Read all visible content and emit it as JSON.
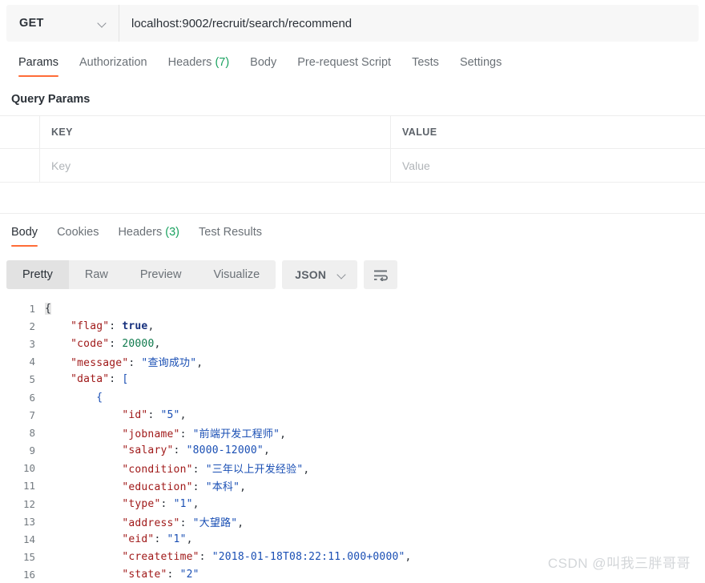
{
  "request_bar": {
    "method": "GET",
    "method_caret_icon": "chevron-down-icon",
    "url": "localhost:9002/recruit/search/recommend"
  },
  "request_tabs": [
    {
      "label": "Params",
      "active": true,
      "count": ""
    },
    {
      "label": "Authorization",
      "active": false,
      "count": ""
    },
    {
      "label": "Headers",
      "active": false,
      "count": "(7)"
    },
    {
      "label": "Body",
      "active": false,
      "count": ""
    },
    {
      "label": "Pre-request Script",
      "active": false,
      "count": ""
    },
    {
      "label": "Tests",
      "active": false,
      "count": ""
    },
    {
      "label": "Settings",
      "active": false,
      "count": ""
    }
  ],
  "query_params": {
    "section_title": "Query Params",
    "columns": [
      "KEY",
      "VALUE"
    ],
    "empty_row": {
      "key_placeholder": "Key",
      "value_placeholder": "Value"
    }
  },
  "response_tabs": [
    {
      "label": "Body",
      "active": true,
      "count": ""
    },
    {
      "label": "Cookies",
      "active": false,
      "count": ""
    },
    {
      "label": "Headers",
      "active": false,
      "count": "(3)"
    },
    {
      "label": "Test Results",
      "active": false,
      "count": ""
    }
  ],
  "view_toolbar": {
    "modes": [
      {
        "label": "Pretty",
        "active": true
      },
      {
        "label": "Raw",
        "active": false
      },
      {
        "label": "Preview",
        "active": false
      },
      {
        "label": "Visualize",
        "active": false
      }
    ],
    "format": "JSON",
    "format_caret_icon": "chevron-down-icon",
    "wrap_icon": "wrap-text-icon"
  },
  "response_body": {
    "language": "json",
    "lines": [
      {
        "num": "1",
        "indent": 0,
        "tokens": [
          {
            "t": "{",
            "c": "p brace-hl"
          }
        ]
      },
      {
        "num": "2",
        "indent": 1,
        "tokens": [
          {
            "t": "\"flag\"",
            "c": "k"
          },
          {
            "t": ": ",
            "c": "p"
          },
          {
            "t": "true",
            "c": "b"
          },
          {
            "t": ",",
            "c": "p"
          }
        ]
      },
      {
        "num": "3",
        "indent": 1,
        "tokens": [
          {
            "t": "\"code\"",
            "c": "k"
          },
          {
            "t": ": ",
            "c": "p"
          },
          {
            "t": "20000",
            "c": "n"
          },
          {
            "t": ",",
            "c": "p"
          }
        ]
      },
      {
        "num": "4",
        "indent": 1,
        "tokens": [
          {
            "t": "\"message\"",
            "c": "k"
          },
          {
            "t": ": ",
            "c": "p"
          },
          {
            "t": "\"查询成功\"",
            "c": "s"
          },
          {
            "t": ",",
            "c": "p"
          }
        ]
      },
      {
        "num": "5",
        "indent": 1,
        "tokens": [
          {
            "t": "\"data\"",
            "c": "k"
          },
          {
            "t": ": ",
            "c": "p"
          },
          {
            "t": "[",
            "c": "s"
          }
        ]
      },
      {
        "num": "6",
        "indent": 2,
        "tokens": [
          {
            "t": "{",
            "c": "s"
          }
        ]
      },
      {
        "num": "7",
        "indent": 3,
        "tokens": [
          {
            "t": "\"id\"",
            "c": "k"
          },
          {
            "t": ": ",
            "c": "p"
          },
          {
            "t": "\"5\"",
            "c": "s"
          },
          {
            "t": ",",
            "c": "p"
          }
        ]
      },
      {
        "num": "8",
        "indent": 3,
        "tokens": [
          {
            "t": "\"jobname\"",
            "c": "k"
          },
          {
            "t": ": ",
            "c": "p"
          },
          {
            "t": "\"前端开发工程师\"",
            "c": "s"
          },
          {
            "t": ",",
            "c": "p"
          }
        ]
      },
      {
        "num": "9",
        "indent": 3,
        "tokens": [
          {
            "t": "\"salary\"",
            "c": "k"
          },
          {
            "t": ": ",
            "c": "p"
          },
          {
            "t": "\"8000-12000\"",
            "c": "s"
          },
          {
            "t": ",",
            "c": "p"
          }
        ]
      },
      {
        "num": "10",
        "indent": 3,
        "tokens": [
          {
            "t": "\"condition\"",
            "c": "k"
          },
          {
            "t": ": ",
            "c": "p"
          },
          {
            "t": "\"三年以上开发经验\"",
            "c": "s"
          },
          {
            "t": ",",
            "c": "p"
          }
        ]
      },
      {
        "num": "11",
        "indent": 3,
        "tokens": [
          {
            "t": "\"education\"",
            "c": "k"
          },
          {
            "t": ": ",
            "c": "p"
          },
          {
            "t": "\"本科\"",
            "c": "s"
          },
          {
            "t": ",",
            "c": "p"
          }
        ]
      },
      {
        "num": "12",
        "indent": 3,
        "tokens": [
          {
            "t": "\"type\"",
            "c": "k"
          },
          {
            "t": ": ",
            "c": "p"
          },
          {
            "t": "\"1\"",
            "c": "s"
          },
          {
            "t": ",",
            "c": "p"
          }
        ]
      },
      {
        "num": "13",
        "indent": 3,
        "tokens": [
          {
            "t": "\"address\"",
            "c": "k"
          },
          {
            "t": ": ",
            "c": "p"
          },
          {
            "t": "\"大望路\"",
            "c": "s"
          },
          {
            "t": ",",
            "c": "p"
          }
        ]
      },
      {
        "num": "14",
        "indent": 3,
        "tokens": [
          {
            "t": "\"eid\"",
            "c": "k"
          },
          {
            "t": ": ",
            "c": "p"
          },
          {
            "t": "\"1\"",
            "c": "s"
          },
          {
            "t": ",",
            "c": "p"
          }
        ]
      },
      {
        "num": "15",
        "indent": 3,
        "tokens": [
          {
            "t": "\"createtime\"",
            "c": "k"
          },
          {
            "t": ": ",
            "c": "p"
          },
          {
            "t": "\"2018-01-18T08:22:11.000+0000\"",
            "c": "s"
          },
          {
            "t": ",",
            "c": "p"
          }
        ]
      },
      {
        "num": "16",
        "indent": 3,
        "tokens": [
          {
            "t": "\"state\"",
            "c": "k"
          },
          {
            "t": ": ",
            "c": "p"
          },
          {
            "t": "\"2\"",
            "c": "s"
          }
        ]
      }
    ]
  },
  "watermark": {
    "text": "CSDN @叫我三胖哥哥"
  }
}
